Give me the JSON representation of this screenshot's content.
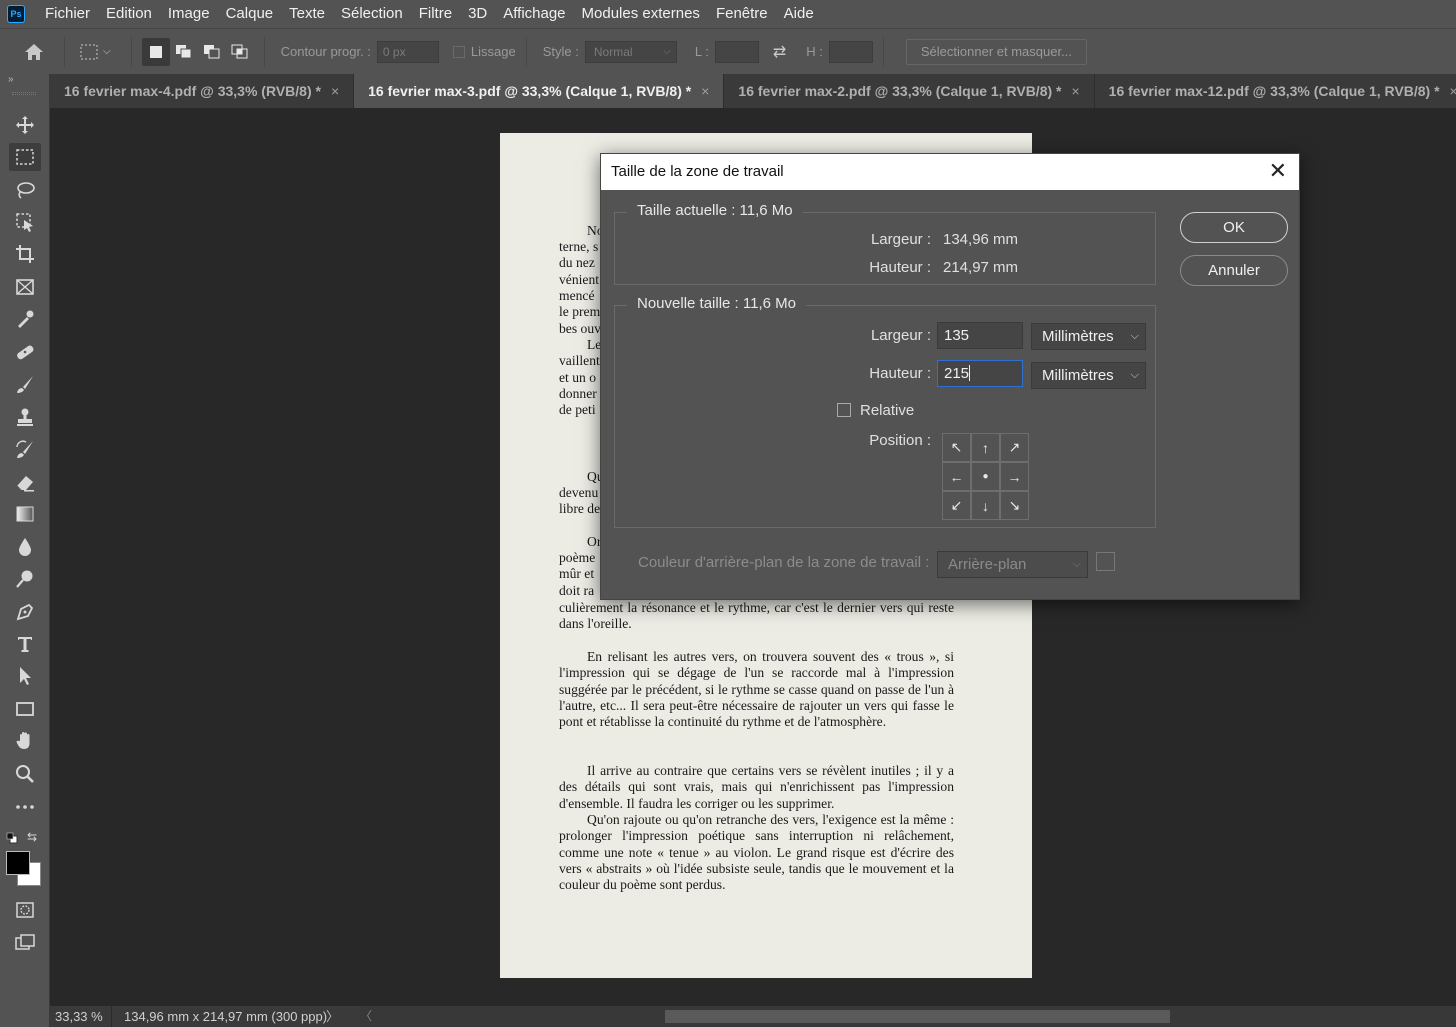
{
  "app": {
    "logo": "Ps",
    "menu": [
      "Fichier",
      "Edition",
      "Image",
      "Calque",
      "Texte",
      "Sélection",
      "Filtre",
      "3D",
      "Affichage",
      "Modules externes",
      "Fenêtre",
      "Aide"
    ]
  },
  "options": {
    "contour_label": "Contour progr. :",
    "contour_value": "0 px",
    "lissage_label": "Lissage",
    "style_label": "Style :",
    "style_value": "Normal",
    "l_label": "L :",
    "h_label": "H :",
    "select_mask": "Sélectionner et masquer..."
  },
  "tabs": [
    {
      "label": "16 fevrier max-4.pdf @ 33,3% (RVB/8) *",
      "active": false
    },
    {
      "label": "16 fevrier max-3.pdf @ 33,3% (Calque 1, RVB/8) *",
      "active": true
    },
    {
      "label": "16 fevrier max-2.pdf @ 33,3% (Calque 1, RVB/8) *",
      "active": false
    },
    {
      "label": "16 fevrier max-12.pdf @ 33,3% (Calque 1, RVB/8) *",
      "active": false
    }
  ],
  "tab_close": "×",
  "tools": [
    "move-tool",
    "rectangular-marquee-tool",
    "lasso-tool",
    "object-selection-tool",
    "crop-tool",
    "frame-tool",
    "eyedropper-tool",
    "healing-brush-tool",
    "brush-tool",
    "clone-stamp-tool",
    "history-brush-tool",
    "eraser-tool",
    "gradient-tool",
    "blur-tool",
    "dodge-tool",
    "pen-tool",
    "type-tool",
    "path-selection-tool",
    "rectangle-tool",
    "hand-tool",
    "zoom-tool",
    "edit-toolbar",
    "default-colors",
    "swap-colors",
    "color-swatches",
    "quick-mask",
    "screen-mode"
  ],
  "status": {
    "zoom": "33,33 %",
    "doc_size": "134,96 mm x 214,97 mm (300 ppp)",
    "arrow": "〉",
    "scroll_left": "〈"
  },
  "document": {
    "fragments": [
      "No",
      "terne, s",
      "du nez",
      "vénient",
      "mencé",
      "le prem",
      "bes ouv",
      "Le",
      "vaillent",
      "et un o",
      "donner",
      "de peti",
      "Qu",
      "devenu",
      "libre de",
      "Or",
      "poème",
      "mûr et",
      "doit ra"
    ],
    "paragraphs": [
      "culièrement la résonance et le rythme, car c'est le dernier vers qui reste dans l'oreille.",
      "En relisant les autres vers, on trouvera souvent des « trous », si l'impression qui se dégage de l'un se raccorde mal à l'impression suggérée par le précédent, si le rythme se casse quand on passe de l'un à l'autre, etc... Il sera peut-être nécessaire de rajouter un vers qui fasse le pont et rétablisse la continuité du rythme et de l'atmosphère.",
      "Il arrive au contraire que certains vers se révèlent inutiles ; il y a des détails qui sont vrais, mais qui n'enrichissent pas l'impression d'ensemble. Il faudra les corriger ou les supprimer.",
      "Qu'on rajoute ou qu'on retranche des vers, l'exigence est la même : prolonger l'impression poétique sans interruption ni relâchement, comme une note « tenue » au violon. Le grand risque est d'écrire des vers « abstraits » où l'idée subsiste seule, tandis que le mouvement et la couleur du poème sont perdus."
    ]
  },
  "dialog": {
    "title": "Taille de la zone de travail",
    "close": "✕",
    "current_legend": "Taille actuelle : 11,6 Mo",
    "current_width_label": "Largeur :",
    "current_width_value": "134,96 mm",
    "current_height_label": "Hauteur :",
    "current_height_value": "214,97 mm",
    "new_legend": "Nouvelle taille : 11,6 Mo",
    "new_width_label": "Largeur :",
    "new_width_value": "135",
    "new_width_unit": "Millimètres",
    "new_height_label": "Hauteur :",
    "new_height_value": "215",
    "new_height_unit": "Millimètres",
    "relative_label": "Relative",
    "relative_checked": false,
    "position_label": "Position :",
    "anchor_arrows": [
      "↖",
      "↑",
      "↗",
      "←",
      "●",
      "→",
      "↙",
      "↓",
      "↘"
    ],
    "bg_color_label": "Couleur d'arrière-plan de la zone de travail :",
    "bg_color_value": "Arrière-plan",
    "ok": "OK",
    "cancel": "Annuler",
    "chevron": "⌵"
  }
}
